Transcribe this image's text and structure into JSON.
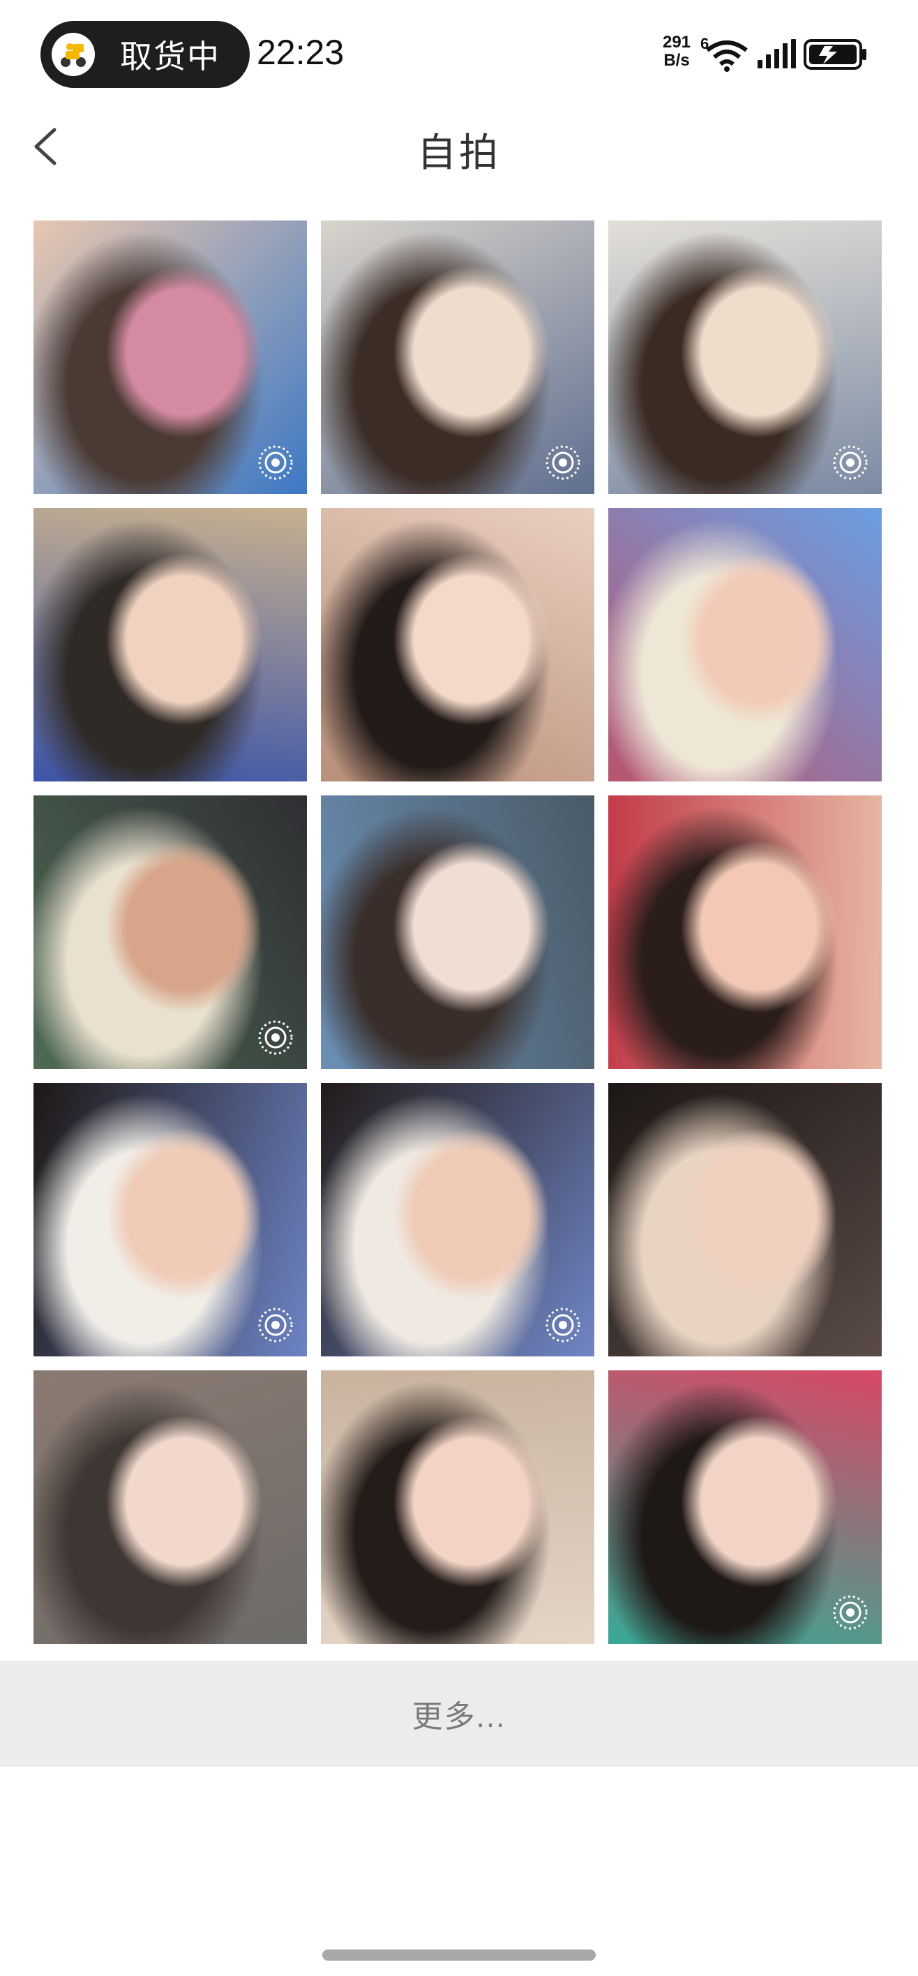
{
  "status_bar": {
    "pill_label": "取货中",
    "time": "22:23",
    "net_speed_value": "291",
    "net_speed_unit": "B/s",
    "wifi_badge": "6",
    "pill_icon": "delivery-scooter-icon",
    "battery_icon": "battery-charging-icon"
  },
  "nav": {
    "title": "自拍",
    "back_icon": "chevron-left-icon"
  },
  "photos": [
    {
      "name": "photo-1",
      "colors": [
        "#e8c7b0",
        "#4a3a33",
        "#d38aa2",
        "#3d78c4"
      ],
      "live": true
    },
    {
      "name": "photo-2",
      "colors": [
        "#d9d4cc",
        "#3b2c25",
        "#efdccc",
        "#5f6f90"
      ],
      "live": true
    },
    {
      "name": "photo-3",
      "colors": [
        "#e3dfd8",
        "#3a2a22",
        "#f0dccb",
        "#7b8aa3"
      ],
      "live": true
    },
    {
      "name": "photo-4",
      "colors": [
        "#c7b08f",
        "#2f2a26",
        "#f1d2c0",
        "#3d55a8"
      ],
      "live": false
    },
    {
      "name": "photo-5",
      "colors": [
        "#e9cfc0",
        "#231b19",
        "#f4d8c8",
        "#b98f79"
      ],
      "live": false
    },
    {
      "name": "photo-6",
      "colors": [
        "#6a9ee3",
        "#efe7d6",
        "#f2cbb8",
        "#b8556f"
      ],
      "live": false
    },
    {
      "name": "photo-7",
      "colors": [
        "#2f2f33",
        "#e9e0cf",
        "#d8a58a",
        "#4d6a54"
      ],
      "live": true
    },
    {
      "name": "photo-8",
      "colors": [
        "#4a5a66",
        "#3a2e2a",
        "#f0ddd3",
        "#6b8fb5"
      ],
      "live": false
    },
    {
      "name": "photo-9",
      "colors": [
        "#e7b7a3",
        "#2a1d1a",
        "#f3c9b6",
        "#c23b4a"
      ],
      "live": false
    },
    {
      "name": "photo-10",
      "colors": [
        "#6d83c4",
        "#f1eee8",
        "#f0cbb7",
        "#1d1715"
      ],
      "live": true
    },
    {
      "name": "photo-11",
      "colors": [
        "#7086c6",
        "#efe9e1",
        "#efcab5",
        "#211a18"
      ],
      "live": true
    },
    {
      "name": "photo-12",
      "colors": [
        "#5a4b46",
        "#e9d4c2",
        "#f1d0c0",
        "#1c1715"
      ],
      "live": false
    },
    {
      "name": "photo-13",
      "colors": [
        "#6d6b68",
        "#3e3632",
        "#f1d8cb",
        "#8b7a72"
      ],
      "live": false
    },
    {
      "name": "photo-14",
      "colors": [
        "#e4d5c7",
        "#241c19",
        "#f2d3c4",
        "#c9b39f"
      ],
      "live": false
    },
    {
      "name": "photo-15",
      "colors": [
        "#37a995",
        "#1e1816",
        "#f1d4c6",
        "#d84865"
      ],
      "live": true
    }
  ],
  "more": {
    "label": "更多..."
  }
}
